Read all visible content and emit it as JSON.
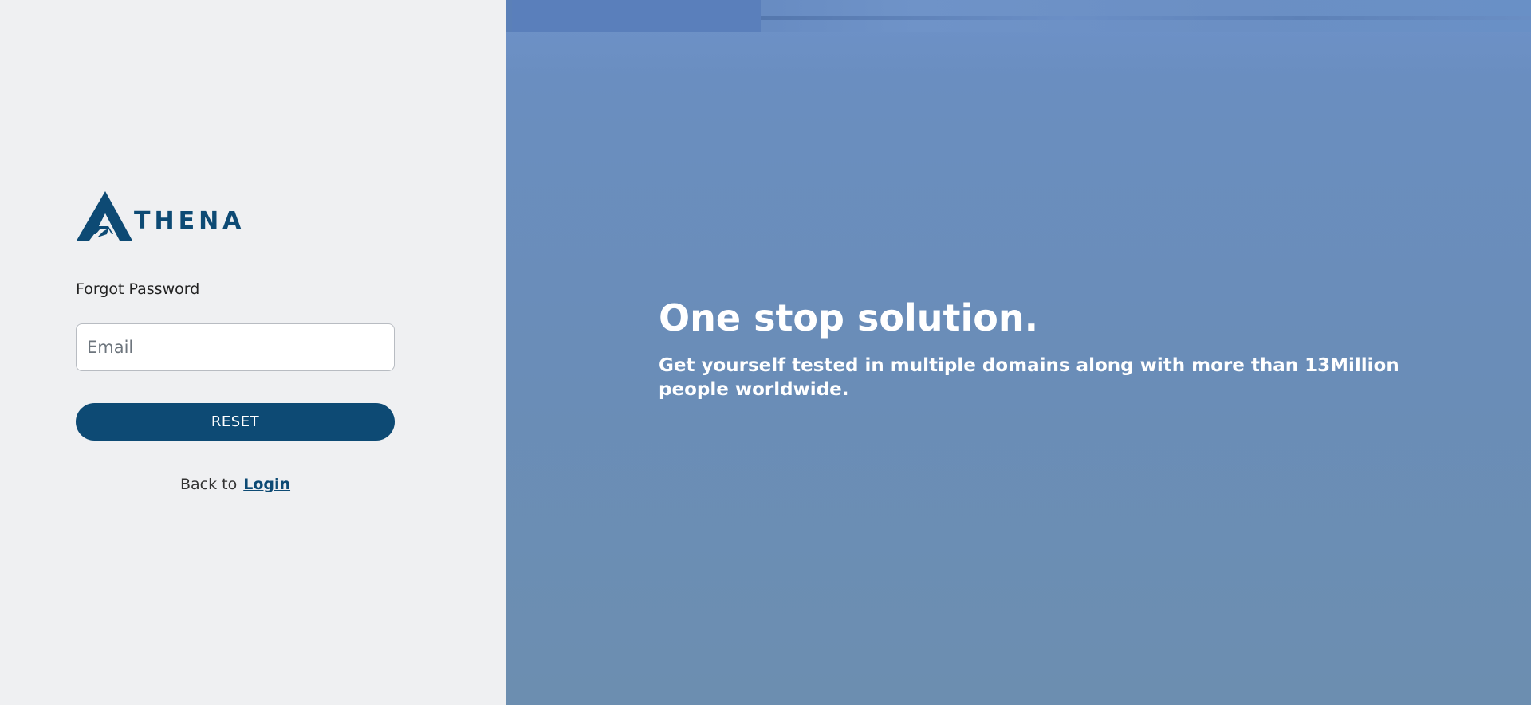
{
  "brand": {
    "logo_text": "THENA",
    "color": "#0d4a74"
  },
  "form": {
    "title": "Forgot Password",
    "email_placeholder": "Email",
    "email_value": "",
    "reset_label": "RESET",
    "back_text": "Back to",
    "login_link": "Login"
  },
  "hero": {
    "title": "One stop solution.",
    "subtitle": "Get yourself tested in multiple domains along with more than 13Million people worldwide."
  },
  "colors": {
    "left_background": "#eff0f2",
    "right_background": "#6a8db8",
    "accent": "#0d4a74"
  }
}
